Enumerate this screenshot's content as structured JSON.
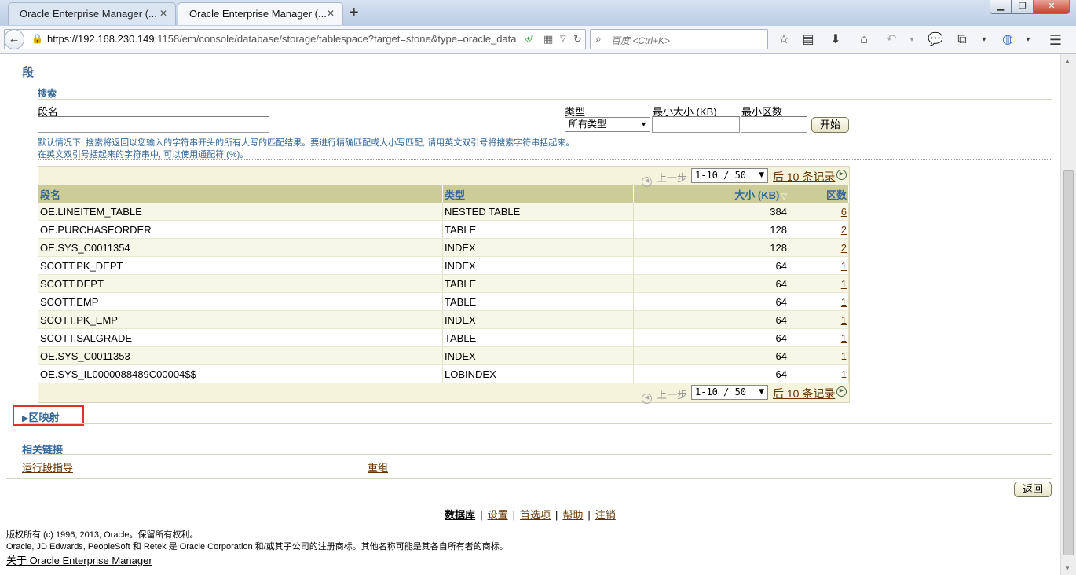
{
  "browser": {
    "tabs": [
      {
        "title": "Oracle Enterprise Manager (...",
        "active": false
      },
      {
        "title": "Oracle Enterprise Manager (...",
        "active": true
      }
    ],
    "url_host": "https://192.168.230.149",
    "url_rest": ":1158/em/console/database/storage/tablespace?target=stone&type=oracle_data",
    "search_placeholder": "百度 <Ctrl+K>"
  },
  "page": {
    "title": "段",
    "search": {
      "heading": "搜索",
      "segment_name_label": "段名",
      "type_label": "类型",
      "type_value": "所有类型",
      "min_size_label": "最小大小 (KB)",
      "min_extents_label": "最小区数",
      "go_button": "开始",
      "hint_line1": "默认情况下, 搜索将返回以您输入的字符串开头的所有大写的匹配结果。要进行精确匹配或大小写匹配, 请用英文双引号将搜索字符串括起来。",
      "hint_line2": "在英文双引号括起来的字符串中, 可以使用通配符 (%)。"
    },
    "pager": {
      "prev": "上一步",
      "range": "1-10 / 50",
      "next": "后 10 条记录"
    },
    "table": {
      "columns": [
        "段名",
        "类型",
        "大小 (KB)",
        "区数"
      ],
      "rows": [
        {
          "name": "OE.LINEITEM_TABLE",
          "type": "NESTED TABLE",
          "size": "384",
          "extents": "6"
        },
        {
          "name": "OE.PURCHASEORDER",
          "type": "TABLE",
          "size": "128",
          "extents": "2"
        },
        {
          "name": "OE.SYS_C0011354",
          "type": "INDEX",
          "size": "128",
          "extents": "2"
        },
        {
          "name": "SCOTT.PK_DEPT",
          "type": "INDEX",
          "size": "64",
          "extents": "1"
        },
        {
          "name": "SCOTT.DEPT",
          "type": "TABLE",
          "size": "64",
          "extents": "1"
        },
        {
          "name": "SCOTT.EMP",
          "type": "TABLE",
          "size": "64",
          "extents": "1"
        },
        {
          "name": "SCOTT.PK_EMP",
          "type": "INDEX",
          "size": "64",
          "extents": "1"
        },
        {
          "name": "SCOTT.SALGRADE",
          "type": "TABLE",
          "size": "64",
          "extents": "1"
        },
        {
          "name": "OE.SYS_C0011353",
          "type": "INDEX",
          "size": "64",
          "extents": "1"
        },
        {
          "name": "OE.SYS_IL0000088489C00004$$",
          "type": "LOBINDEX",
          "size": "64",
          "extents": "1"
        }
      ]
    },
    "extent_map_label": "区映射",
    "related_links": {
      "heading": "相关链接",
      "link1": "运行段指导",
      "link2": "重组"
    },
    "return_button": "返回",
    "footer_nav": {
      "database": "数据库",
      "setup": "设置",
      "preferences": "首选项",
      "help": "帮助",
      "logout": "注销"
    },
    "copyright1": "版权所有 (c) 1996, 2013, Oracle。保留所有权利。",
    "copyright2": "Oracle, JD Edwards, PeopleSoft 和 Retek 是 Oracle Corporation 和/或其子公司的注册商标。其他名称可能是其各自所有者的商标。",
    "about_link": "关于 Oracle Enterprise Manager"
  }
}
